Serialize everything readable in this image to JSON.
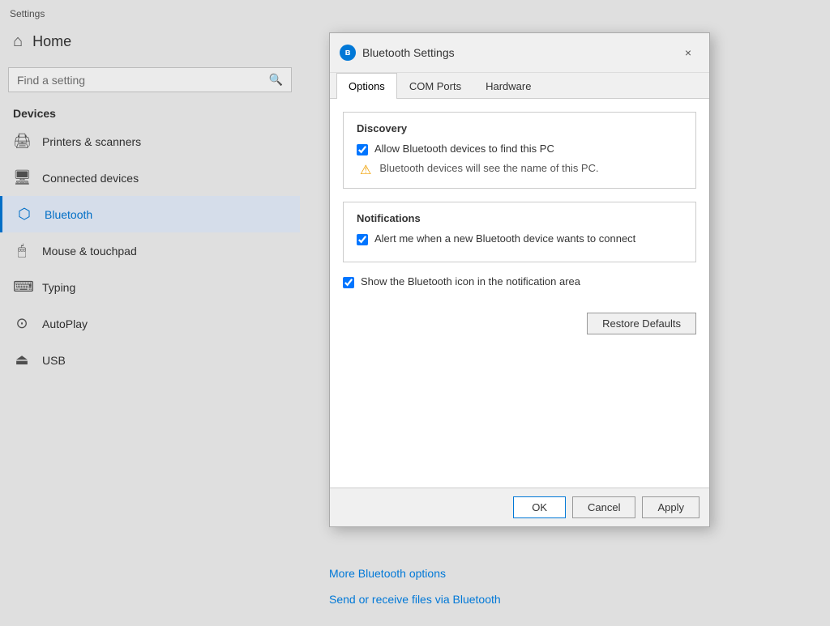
{
  "app": {
    "title": "Settings"
  },
  "sidebar": {
    "home_label": "Home",
    "search_placeholder": "Find a setting",
    "devices_label": "Devices",
    "nav_items": [
      {
        "id": "printers",
        "label": "Printers & scanners",
        "icon": "🖨"
      },
      {
        "id": "connected",
        "label": "Connected devices",
        "icon": "🖥"
      },
      {
        "id": "bluetooth",
        "label": "Bluetooth",
        "icon": "⬡",
        "active": true
      },
      {
        "id": "mouse",
        "label": "Mouse & touchpad",
        "icon": "🖱"
      },
      {
        "id": "typing",
        "label": "Typing",
        "icon": "⌨"
      },
      {
        "id": "autoplay",
        "label": "AutoPlay",
        "icon": "⊙"
      },
      {
        "id": "usb",
        "label": "USB",
        "icon": "⏏"
      }
    ]
  },
  "dialog": {
    "title": "Bluetooth Settings",
    "close_label": "×",
    "tabs": [
      {
        "id": "options",
        "label": "Options",
        "active": true
      },
      {
        "id": "com_ports",
        "label": "COM Ports"
      },
      {
        "id": "hardware",
        "label": "Hardware"
      }
    ],
    "discovery": {
      "section_title": "Discovery",
      "allow_label": "Allow Bluetooth devices to find this PC",
      "warning_text": "Bluetooth devices will see the name of this PC."
    },
    "notifications": {
      "section_title": "Notifications",
      "alert_label": "Alert me when a new Bluetooth device wants to connect",
      "show_icon_label": "Show the Bluetooth icon in the notification area"
    },
    "restore_button": "Restore Defaults",
    "footer": {
      "ok_label": "OK",
      "cancel_label": "Cancel",
      "apply_label": "Apply"
    }
  },
  "links": {
    "more_options": "More Bluetooth options",
    "send_receive": "Send or receive files via Bluetooth"
  }
}
